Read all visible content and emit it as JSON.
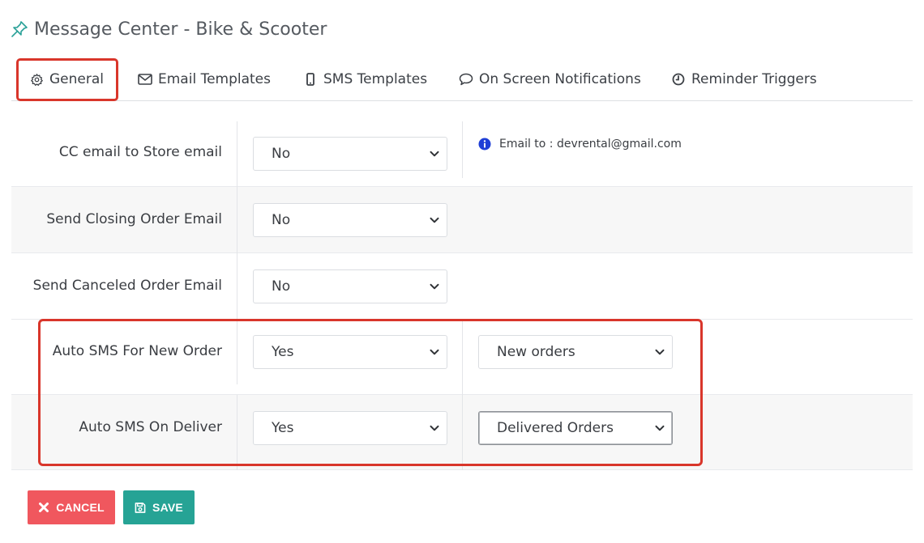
{
  "header": {
    "title": "Message Center - Bike & Scooter",
    "icon": "pin-icon"
  },
  "tabs": [
    {
      "label": "General",
      "icon": "gear-icon",
      "active": true
    },
    {
      "label": "Email Templates",
      "icon": "envelope-icon"
    },
    {
      "label": "SMS Templates",
      "icon": "mobile-icon"
    },
    {
      "label": "On Screen Notifications",
      "icon": "comment-icon"
    },
    {
      "label": "Reminder Triggers",
      "icon": "clock-icon"
    }
  ],
  "settings": {
    "cc_email": {
      "label": "CC email to Store email",
      "value": "No",
      "info": "Email to : devrental@gmail.com"
    },
    "closing_email": {
      "label": "Send Closing Order Email",
      "value": "No"
    },
    "canceled_email": {
      "label": "Send Canceled Order Email",
      "value": "No"
    },
    "sms_new_order": {
      "label": "Auto SMS For New Order",
      "value": "Yes",
      "template": "New orders"
    },
    "sms_deliver": {
      "label": "Auto SMS On Deliver",
      "value": "Yes",
      "template": "Delivered Orders"
    }
  },
  "actions": {
    "cancel_label": "CANCEL",
    "save_label": "SAVE"
  },
  "colors": {
    "highlight": "#d9362b",
    "cancel": "#f0575e",
    "save": "#26a395",
    "info": "#1f3fd6",
    "pin": "#2aa198"
  }
}
